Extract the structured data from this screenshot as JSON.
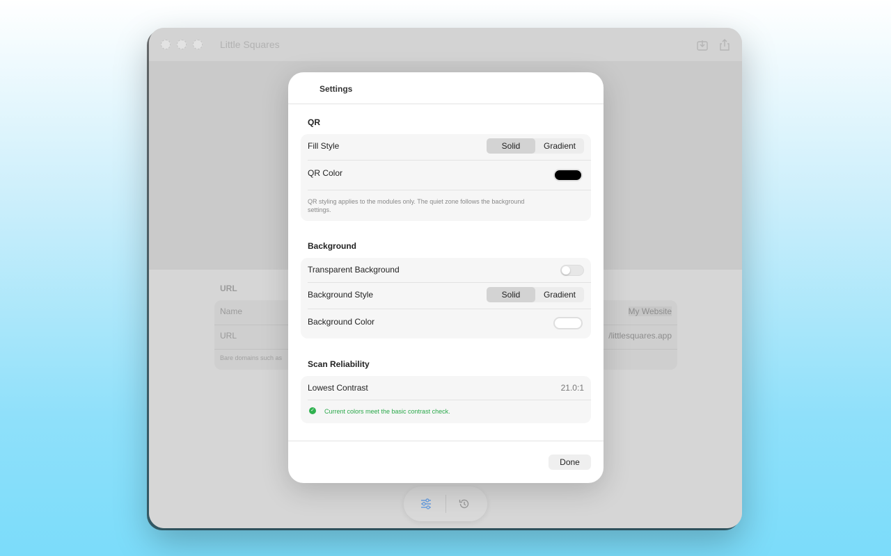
{
  "window": {
    "title": "Little Squares",
    "toolbar_icons": [
      "download-icon",
      "share-icon"
    ]
  },
  "form": {
    "section_title": "URL",
    "rows": [
      {
        "label": "Name",
        "value": "My Website"
      },
      {
        "label": "URL",
        "value": "/littlesquares.app"
      }
    ],
    "note": "Bare domains such as"
  },
  "bottom_bar": {
    "icons": [
      "sliders-icon",
      "history-icon"
    ],
    "accent": "#6a9fe0"
  },
  "settings": {
    "title": "Settings",
    "qr": {
      "section_title": "QR",
      "fill_style_label": "Fill Style",
      "fill_style_options": [
        "Solid",
        "Gradient"
      ],
      "fill_style_selected": "Solid",
      "color_label": "QR Color",
      "color_value": "#000000",
      "note": "QR styling applies to the modules only. The quiet zone follows the background settings."
    },
    "background": {
      "section_title": "Background",
      "transparent_label": "Transparent Background",
      "transparent_on": false,
      "style_label": "Background Style",
      "style_options": [
        "Solid",
        "Gradient"
      ],
      "style_selected": "Solid",
      "color_label": "Background Color",
      "color_value": "#ffffff"
    },
    "scan": {
      "section_title": "Scan Reliability",
      "contrast_label": "Lowest Contrast",
      "contrast_value": "21.0:1",
      "status_text": "Current colors meet the basic contrast check.",
      "status_color": "#2aa84a"
    },
    "done_label": "Done"
  }
}
